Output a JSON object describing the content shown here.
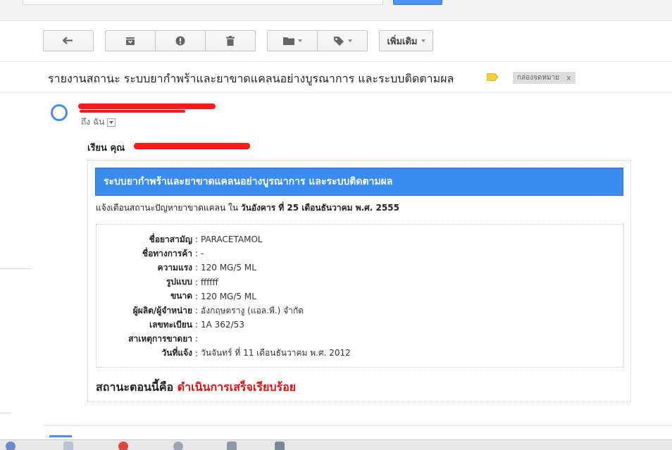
{
  "subject": "รายงานสถานะ ระบบยากำพร้าและยาขาดแคลนอย่างบูรณาการ และระบบติดตามผล",
  "inbox_label": "กล่องจดหมาย",
  "inbox_label_remove": "x",
  "toolbar": {
    "more_label": "เพิ่มเติม"
  },
  "sender": {
    "to_me": "ถึง ฉัน"
  },
  "greeting": "เรียน คุณ",
  "mail": {
    "header": "ระบบยากำพร้าและยาขาดแคลนอย่างบูรณาการ และระบบติดตามผล",
    "notice_prefix": "แจ้งเตือนสถานะปัญหายาขาดแคลน ใน ",
    "notice_date": "วันอังคาร ที่ 25 เดือนธันวาคม พ.ศ. 2555",
    "details": [
      {
        "label": "ชื่อยาสามัญ",
        "value": "PARACETAMOL"
      },
      {
        "label": "ชื่อทางการค้า",
        "value": "-"
      },
      {
        "label": "ความแรง",
        "value": "120 MG/5 ML"
      },
      {
        "label": "รูปแบบ",
        "value": "ffffff"
      },
      {
        "label": "ขนาด",
        "value": "120 MG/5 ML"
      },
      {
        "label": "ผู้ผลิต/ผู้จำหน่าย",
        "value": "อังกฤษตรางู (แอล.พี.) จำกัด"
      },
      {
        "label": "เลขทะเบียน",
        "value": "1A 362/53"
      },
      {
        "label": "สาเหตุการขาดยา",
        "value": ""
      },
      {
        "label": "วันที่แจ้ง",
        "value": "วันจันทร์ ที่ 11 เดือนธันวาคม พ.ศ. 2012"
      }
    ],
    "status_prefix": "สถานะตอนนี้คือ ",
    "status_value": "ดำเนินการเสร็จเรียบร้อย"
  },
  "colors": {
    "header_blue": "#3a8cf0",
    "status_red": "#e01010",
    "redaction": "#ff1a1a",
    "sender_ring": "#4a8af4"
  },
  "icons": [
    "reply-icon",
    "archive-icon",
    "report-spam-icon",
    "delete-icon",
    "folder-icon",
    "label-icon"
  ]
}
